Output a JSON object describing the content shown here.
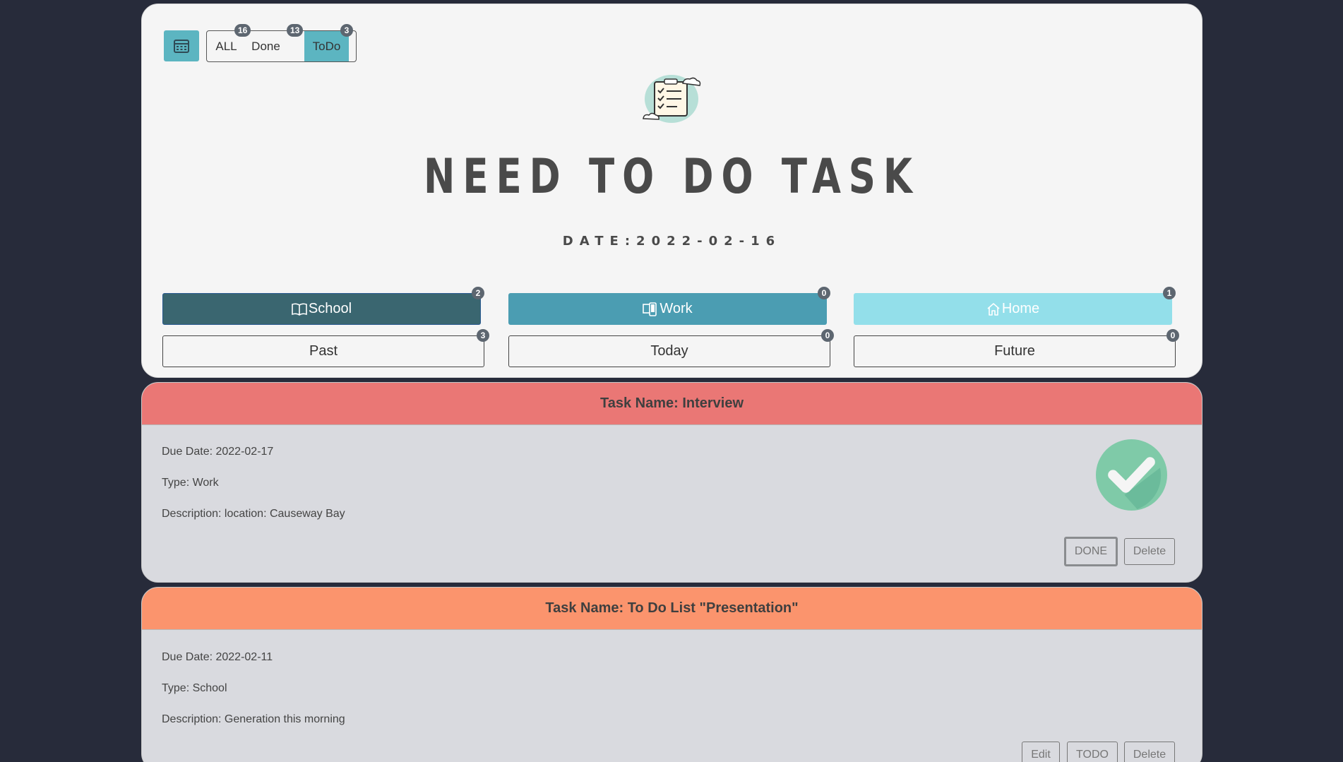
{
  "header": {
    "calendar_icon": "calendar-icon",
    "filters": [
      {
        "label": "ALL",
        "count": "16"
      },
      {
        "label": "Done",
        "count": "13"
      },
      {
        "label": "ToDo",
        "count": "3"
      }
    ],
    "active_filter": "ToDo",
    "title": "NEED TO DO TASK",
    "date": "DATE:2022-02-16"
  },
  "categories": [
    {
      "label": "School",
      "icon": "book-icon",
      "count": "2",
      "color": "#3a6670"
    },
    {
      "label": "Work",
      "icon": "devices-icon",
      "count": "0",
      "color": "#4b9db2"
    },
    {
      "label": "Home",
      "icon": "home-icon",
      "count": "1",
      "color": "#93dfea"
    }
  ],
  "timeframes": [
    {
      "label": "Past",
      "count": "3"
    },
    {
      "label": "Today",
      "count": "0"
    },
    {
      "label": "Future",
      "count": "0"
    }
  ],
  "tasks": [
    {
      "name": "Task Name: Interview",
      "header_color": "#ea7775",
      "due": "Due Date: 2022-02-17",
      "type": "Type: Work",
      "description": "Description: location: Causeway Bay",
      "status_icon": "checkmark-icon",
      "buttons": [
        "DONE",
        "Delete"
      ]
    },
    {
      "name": "Task Name: To Do List \"Presentation\"",
      "header_color": "#fb946d",
      "due": "Due Date: 2022-02-11",
      "type": "Type: School",
      "description": "Description: Generation this morning",
      "buttons": [
        "Edit",
        "TODO",
        "Delete"
      ]
    }
  ]
}
